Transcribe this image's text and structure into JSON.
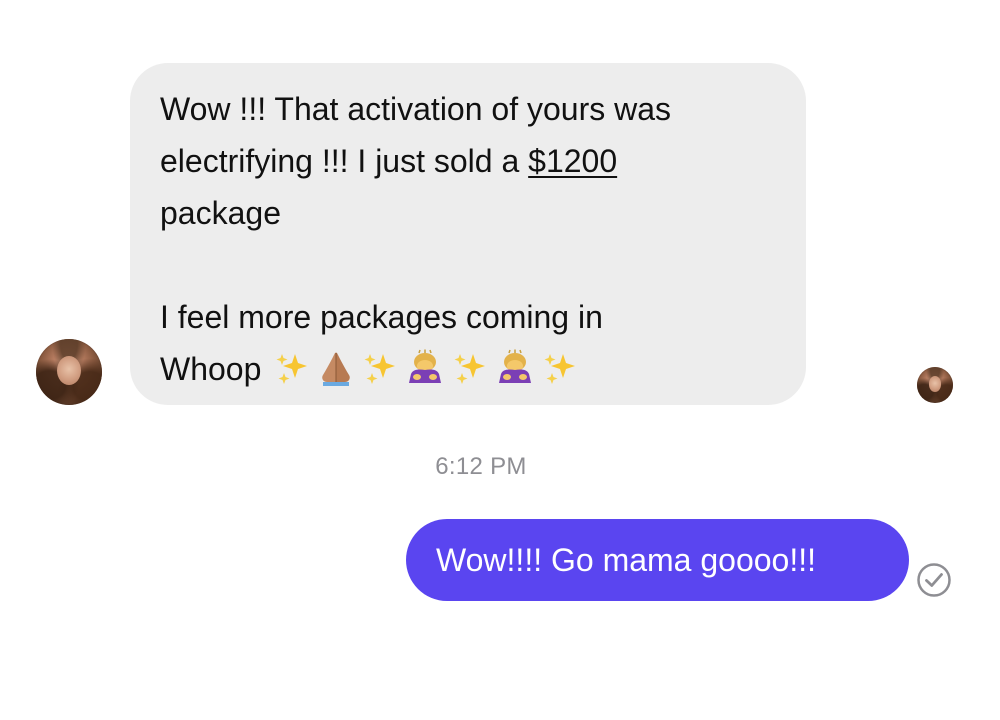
{
  "conversation": {
    "incoming": {
      "line1": "Wow !!! That activation of yours was",
      "line2_prefix": "electrifying !!! I just sold a ",
      "amount": "$1200",
      "line3": "package",
      "line4": "I feel more packages coming in",
      "line5": "Whoop",
      "emojis": [
        "sparkles-icon",
        "folded-hands-icon",
        "sparkles-icon",
        "bowing-woman-icon",
        "sparkles-icon",
        "bowing-woman-icon",
        "sparkles-icon"
      ]
    },
    "timestamp": "6:12 PM",
    "outgoing": {
      "text": "Wow!!!! Go mama goooo!!!"
    },
    "status": "read-receipt-check-icon"
  },
  "colors": {
    "incoming_bubble": "#ededed",
    "outgoing_bubble": "#5a45f0",
    "timestamp_text": "#8e8e93",
    "check_ring": "#8e8e93"
  }
}
